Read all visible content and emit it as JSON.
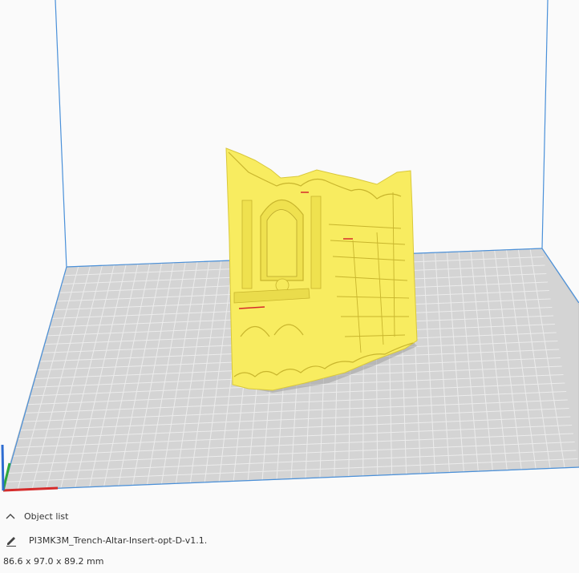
{
  "viewport": {
    "model_color": "#f8ec60",
    "model_shadow": "#e8d84a",
    "build_plate_color": "#d4d4d4",
    "grid_line_color": "#ffffff",
    "volume_edge_color": "#4a90d9",
    "axis_colors": {
      "x": "#d52b2b",
      "y": "#2fa83b",
      "z": "#2d6cd1"
    }
  },
  "object_list": {
    "toggle_icon": "chevron-up-icon",
    "header_label": "Object list",
    "edit_icon": "pencil-icon",
    "object_name": "PI3MK3M_Trench-Altar-Insert-opt-D-v1.1.",
    "dimensions": "86.6 x 97.0 x 89.2 mm"
  }
}
